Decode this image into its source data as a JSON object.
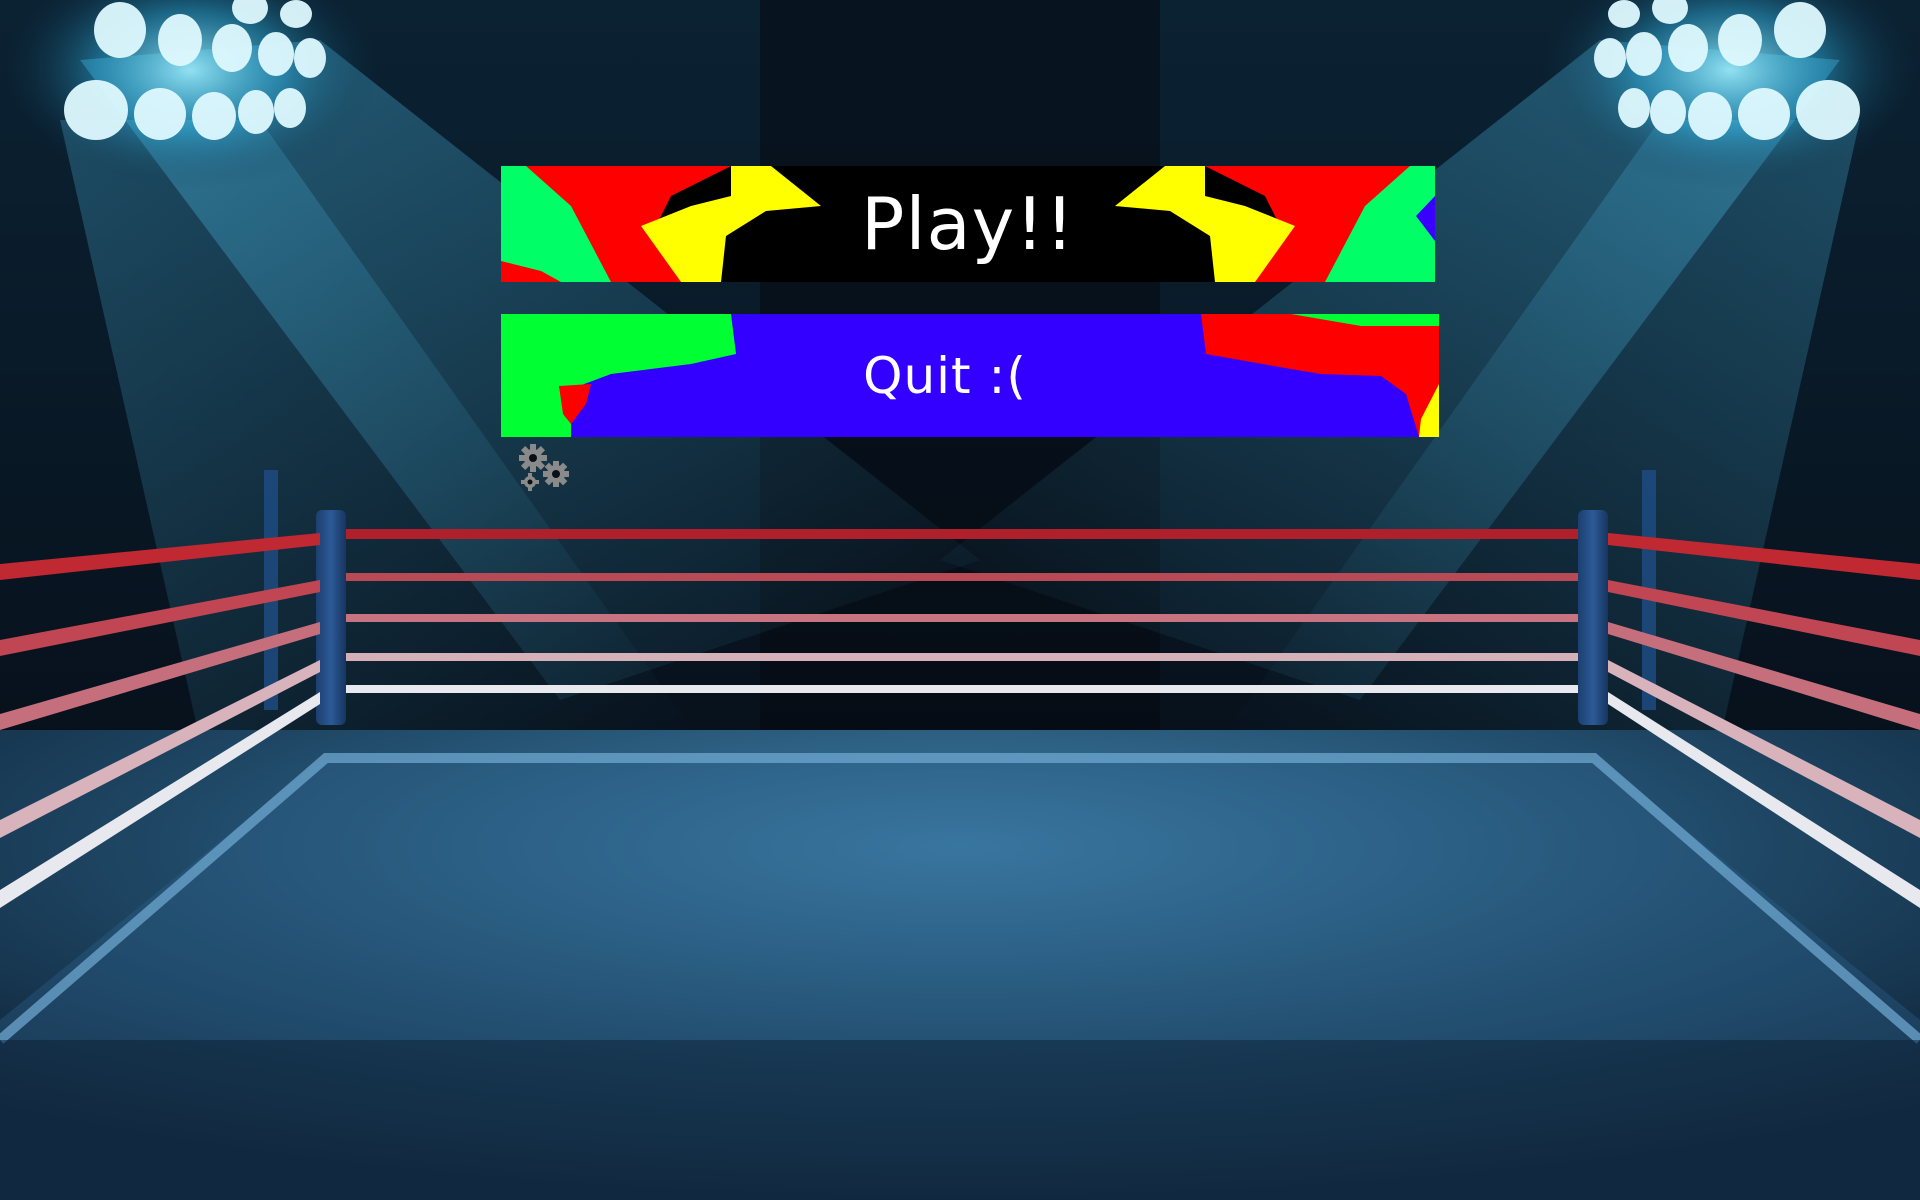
{
  "menu": {
    "play_label": "Play!!",
    "quit_label": "Quit :(",
    "settings_icon": "gears-icon"
  },
  "colors": {
    "play_bg": "#000000",
    "quit_bg": "#3300ff",
    "art_red": "#ff0000",
    "art_green": "#00ff66",
    "art_yellow": "#ffff00",
    "art_blue": "#3a00ff",
    "gear": "#8a8a8a"
  }
}
